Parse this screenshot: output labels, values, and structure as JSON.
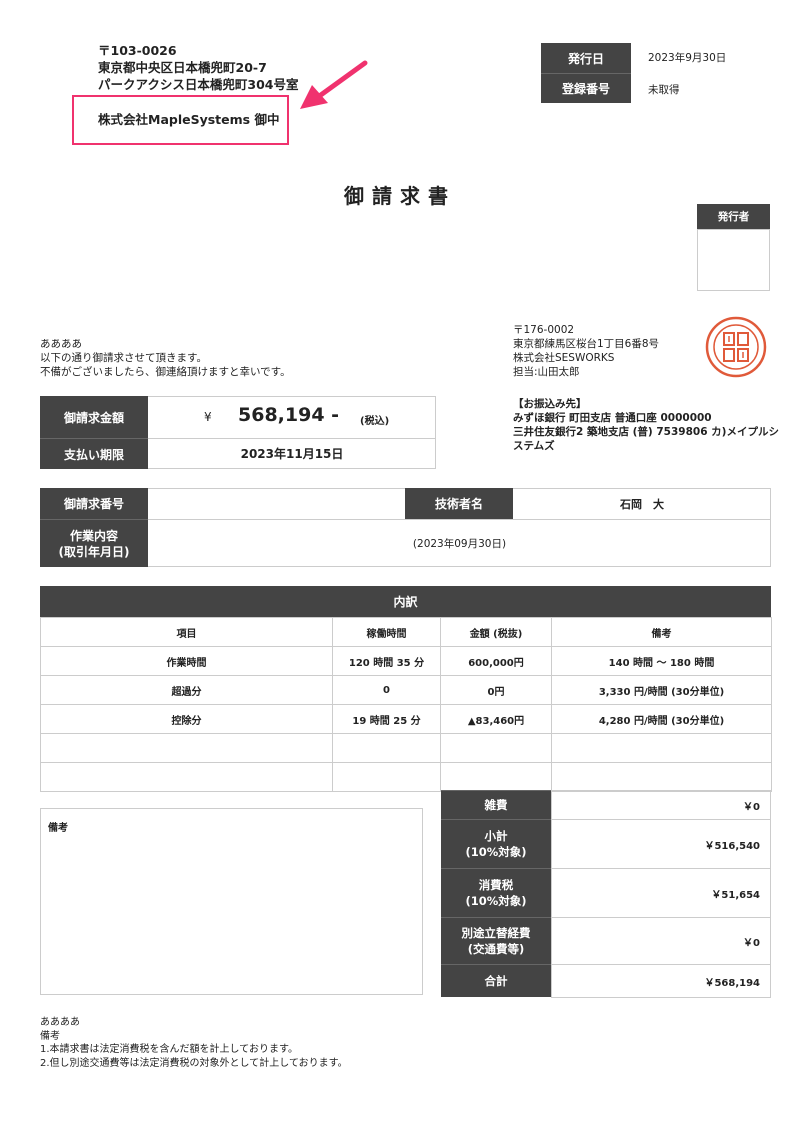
{
  "customer": {
    "postal": "〒103-0026",
    "address1": "東京都中央区日本橋兜町20-7",
    "address2": "パークアクシス日本橋兜町304号室",
    "name": "株式会社MapleSystems 御中"
  },
  "meta": {
    "issue_date_label": "発行日",
    "issue_date": "2023年9月30日",
    "reg_no_label": "登録番号",
    "reg_no": "未取得"
  },
  "title": "御請求書",
  "issuer_box_label": "発行者",
  "greeting": {
    "line1": "ああああ",
    "line2": "以下の通り御請求させて頂きます。",
    "line3": "不備がございましたら、御連絡頂けますと幸いです。"
  },
  "issuer": {
    "postal": "〒176-0002",
    "address": "東京都練馬区桜台1丁目6番8号",
    "company": "株式会社SESWORKS",
    "contact": "担当:山田太郎"
  },
  "bank": {
    "label": "【お振込み先】",
    "line1": "みずほ銀行 町田支店 普通口座 0000000",
    "line2": "三井住友銀行2 築地支店 (普) 7539806 カ)メイプルシ",
    "line3": "ステムズ"
  },
  "amount": {
    "label": "御請求金額",
    "currency": "¥",
    "value": "568,194 -",
    "tax_note": "(税込)",
    "due_label": "支払い期限",
    "due_date": "2023年11月15日"
  },
  "info": {
    "invoice_no_label": "御請求番号",
    "invoice_no": "",
    "engineer_label": "技術者名",
    "engineer": "石岡　大",
    "work_label_1": "作業内容",
    "work_label_2": "(取引年月日)",
    "work_value": "(2023年09月30日)"
  },
  "breakdown": {
    "title": "内訳",
    "headers": [
      "項目",
      "稼働時間",
      "金額 (税抜)",
      "備考"
    ],
    "rows": [
      [
        "作業時間",
        "120 時間 35 分",
        "600,000円",
        "140 時間 〜 180 時間"
      ],
      [
        "超過分",
        "0",
        "0円",
        "3,330 円/時間 (30分単位)"
      ],
      [
        "控除分",
        "19 時間 25 分",
        "▲83,460円",
        "4,280 円/時間 (30分単位)"
      ],
      [
        "",
        "",
        "",
        ""
      ],
      [
        "",
        "",
        "",
        ""
      ]
    ]
  },
  "notes_box_label": "備考",
  "totals": [
    {
      "label1": "雑費",
      "label2": "",
      "value": "￥0"
    },
    {
      "label1": "小計",
      "label2": "(10%対象)",
      "value": "￥516,540"
    },
    {
      "label1": "消費税",
      "label2": "(10%対象)",
      "value": "￥51,654"
    },
    {
      "label1": "別途立替経費",
      "label2": "(交通費等)",
      "value": "￥0"
    },
    {
      "label1": "合計",
      "label2": "",
      "value": "￥568,194"
    }
  ],
  "footer": {
    "line1": "ああああ",
    "line2": "備考",
    "line3": "1.本請求書は法定消費税を含んだ額を計上しております。",
    "line4": "2.但し別途交通費等は法定消費税の対象外として計上しております。"
  },
  "colors": {
    "dark": "#444444",
    "highlight": "#f0326e",
    "seal": "#e05a3a"
  }
}
